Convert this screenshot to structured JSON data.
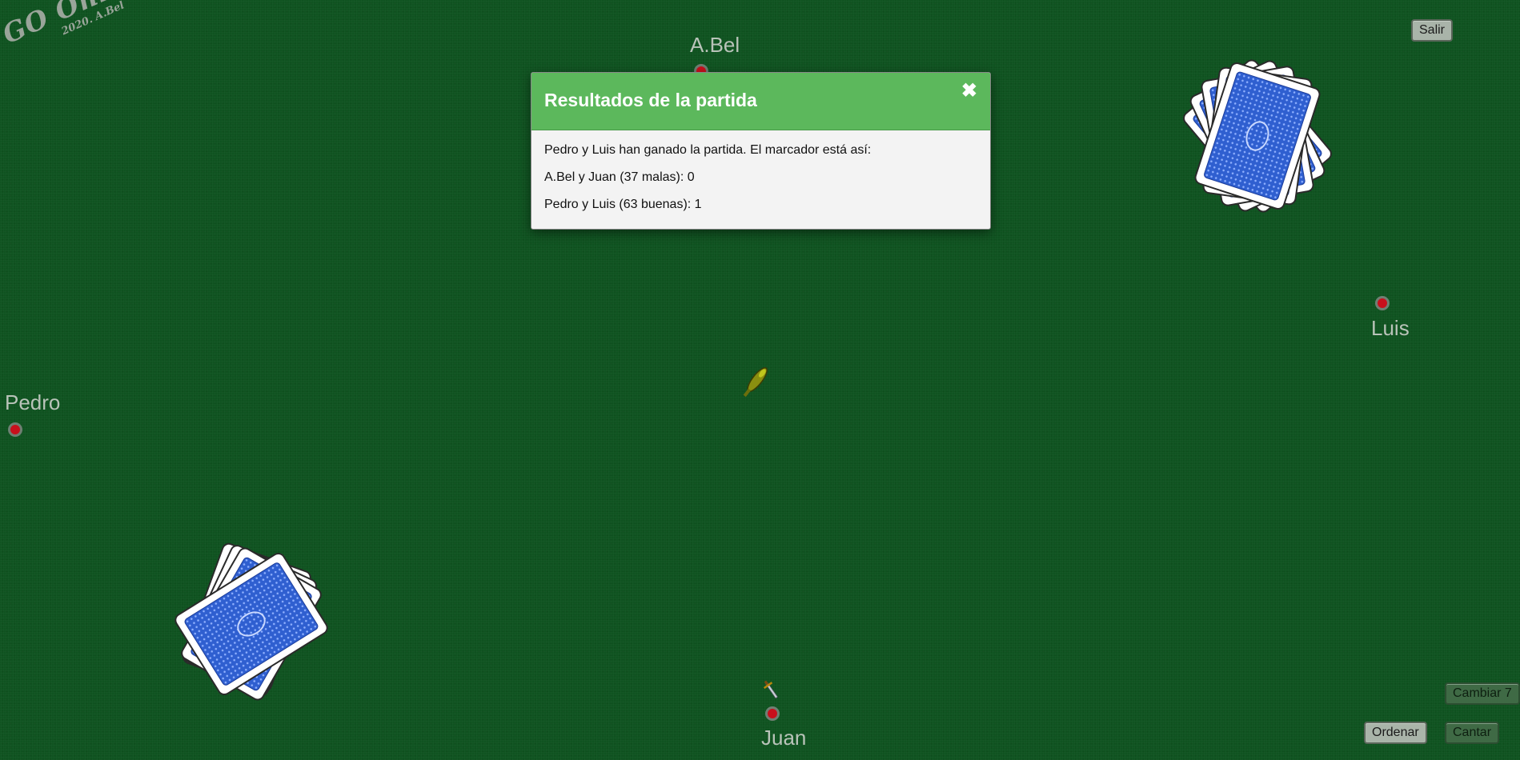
{
  "logo": {
    "title": "GO Online",
    "subtitle": "2020. A.Bel"
  },
  "toolbar": {
    "exit_label": "Salir",
    "swap_seven_label": "Cambiar 7",
    "sort_label": "Ordenar",
    "sing_label": "Cantar"
  },
  "players": {
    "top": "A.Bel",
    "right": "Luis",
    "left": "Pedro",
    "bottom": "Juan"
  },
  "modal": {
    "title": "Resultados de la partida",
    "close_glyph": "✖",
    "lines": [
      "Pedro y Luis han ganado la partida. El marcador está así:",
      "A.Bel y Juan (37 malas): 0",
      "Pedro y Luis (63 buenas): 1"
    ]
  },
  "icons": {
    "deck": "card-back-deck-icon",
    "center_card": "trump-card-icon",
    "sword": "sword-token-icon",
    "player_marker": "player-dot-icon"
  },
  "colors": {
    "table": "#0f5320",
    "modal_header": "#5cb85c",
    "player_dot": "#c8101c",
    "card_back": "#2f5fd0"
  }
}
